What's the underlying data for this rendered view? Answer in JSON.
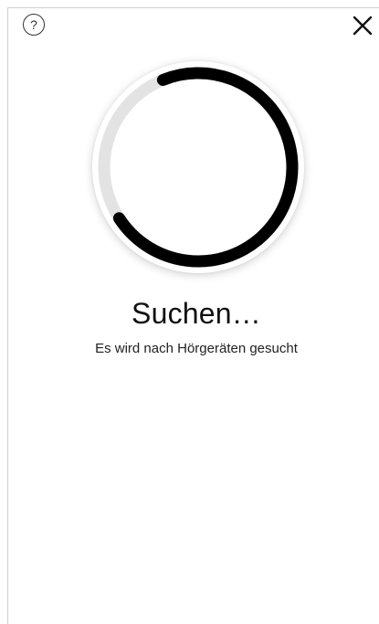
{
  "header": {
    "help_icon": "question-circle-icon",
    "help_glyph": "?",
    "close_icon": "close-icon"
  },
  "spinner": {
    "progress_fraction": 0.72
  },
  "status": {
    "title": "Suchen…",
    "subtitle": "Es wird nach Hörgeräten gesucht"
  },
  "colors": {
    "spinner_track": "#e3e3e3",
    "spinner_arc": "#000000",
    "text": "#111111"
  }
}
